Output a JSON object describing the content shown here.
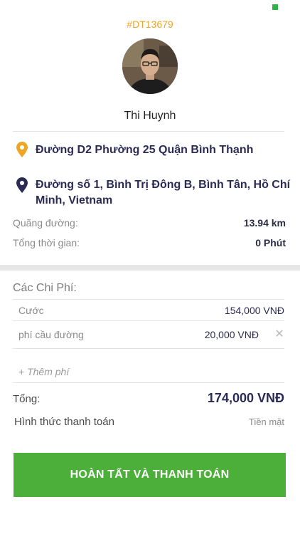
{
  "trip": {
    "order_id": "#DT13679",
    "driver_name": "Thi Huynh",
    "pickup_address": "Đường D2 Phường 25 Quận Bình Thạnh",
    "dropoff_address": "Đường số 1, Bình Trị Đông B, Bình Tân, Hồ Chí Minh, Vietnam",
    "distance_label": "Quãng đường:",
    "distance_value": "13.94 km",
    "duration_label": "Tổng thời gian:",
    "duration_value": "0 Phút"
  },
  "costs": {
    "title": "Các Chi Phí:",
    "items": [
      {
        "label": "Cước",
        "value": "154,000 VNĐ"
      },
      {
        "label": "phí cầu đường",
        "value": "20,000 VNĐ"
      }
    ],
    "add_fee_placeholder": "+ Thêm phí",
    "total_label": "Tổng:",
    "total_value": "174,000 VNĐ",
    "payment_label": "Hình thức thanh toán",
    "payment_value": "Tiền mặt"
  },
  "actions": {
    "finish_label": "HOÀN TẤT VÀ THANH TOÁN"
  },
  "colors": {
    "accent_orange": "#f0a522",
    "button_green": "#4caf39",
    "text_navy": "#2b2b55"
  },
  "icons": {
    "pickup": "map-pin-orange-icon",
    "dropoff": "map-pin-navy-icon",
    "remove": "close-icon"
  }
}
